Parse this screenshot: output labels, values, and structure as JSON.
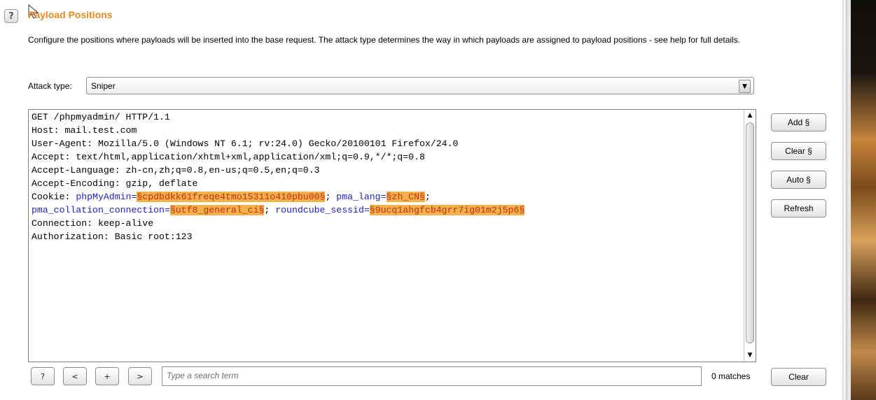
{
  "section": {
    "title": "Payload Positions",
    "description": "Configure the positions where payloads will be inserted into the base request. The attack type determines the way in which payloads are assigned to payload positions - see help for full details.",
    "help_label": "?"
  },
  "attack_type": {
    "label": "Attack type:",
    "selected": "Sniper"
  },
  "request": {
    "line1": "GET /phpmyadmin/ HTTP/1.1",
    "line2": "Host: mail.test.com",
    "line3": "User-Agent: Mozilla/5.0 (Windows NT 6.1; rv:24.0) Gecko/20100101 Firefox/24.0",
    "line4": "Accept: text/html,application/xhtml+xml,application/xml;q=0.9,*/*;q=0.8",
    "line5": "Accept-Language: zh-cn,zh;q=0.8,en-us;q=0.5,en;q=0.3",
    "line6": "Accept-Encoding: gzip, deflate",
    "cookie_prefix": "Cookie: ",
    "cookie_name1": "phpMyAdmin",
    "cookie_val1": "§cpdbdkk61freqe4tmo15311o410pbu00§",
    "cookie_name2": "pma_lang",
    "cookie_val2": "§zh_CN§",
    "cookie_name3": "pma_collation_connection",
    "cookie_val3": "§utf8_general_ci§",
    "cookie_name4": "roundcube_sessid",
    "cookie_val4": "§9ucq1ahgfcb4grr7ig01m2j5p6§",
    "line9": "Connection: keep-alive",
    "line10": "Authorization: Basic root:123"
  },
  "side_buttons": {
    "add": "Add §",
    "clear": "Clear §",
    "auto": "Auto §",
    "refresh": "Refresh"
  },
  "search": {
    "help": "?",
    "prev": "<",
    "add": "+",
    "next": ">",
    "placeholder": "Type a search term",
    "matches": "0 matches",
    "clear": "Clear"
  }
}
